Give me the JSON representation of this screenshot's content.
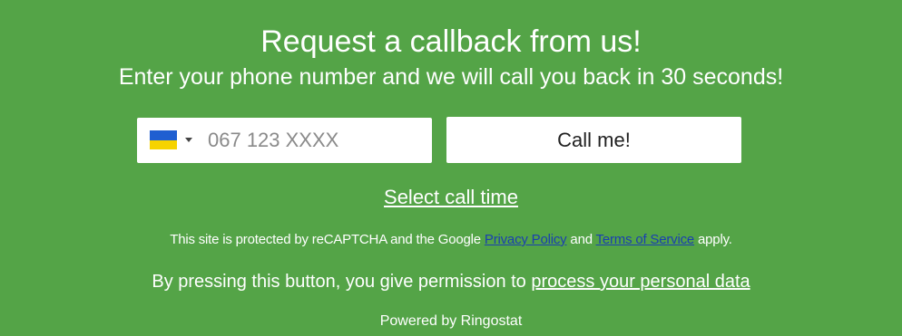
{
  "callback": {
    "title": "Request a callback from us!",
    "subtitle": "Enter your phone number and we will call you back in 30 seconds!",
    "phone": {
      "country_flag": "ukraine-flag-icon",
      "flag_colors": [
        "#1f5fd1",
        "#f6d300"
      ],
      "placeholder": "067 123 XXXX",
      "value": ""
    },
    "call_button_label": "Call me!",
    "select_time_label": "Select call time",
    "recaptcha": {
      "prefix": "This site is protected by reCAPTCHA and the Google ",
      "privacy_link": "Privacy Policy",
      "middle": " and ",
      "terms_link": "Terms of Service",
      "suffix": " apply."
    },
    "consent": {
      "prefix": "By pressing this button, you give permission to ",
      "link": "process your personal data"
    },
    "powered_by": "Powered by Ringostat"
  },
  "colors": {
    "background": "#54a447",
    "link_blue": "#1a3fb0",
    "text": "#ffffff"
  }
}
